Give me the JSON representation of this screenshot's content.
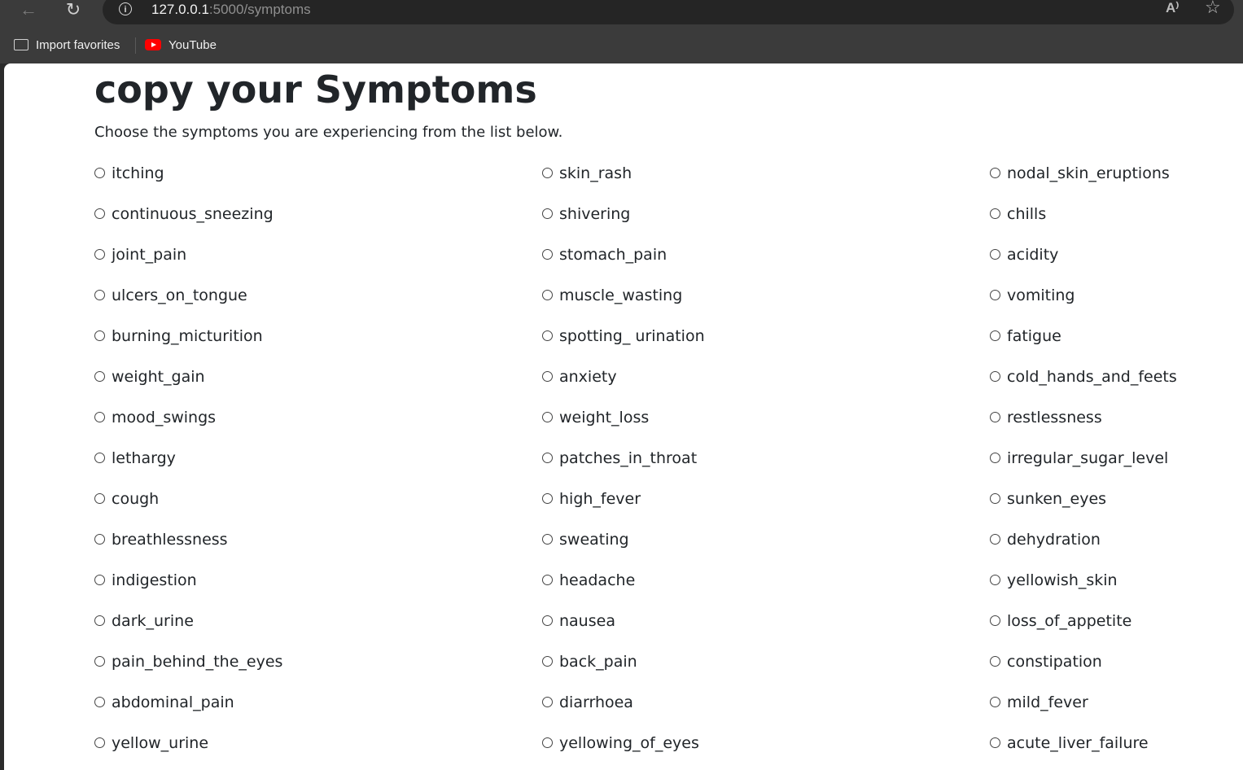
{
  "browser": {
    "url_host": "127.0.0.1",
    "url_rest": ":5000/symptoms",
    "back_icon": "←",
    "reload_icon": "↻",
    "info_icon": "i",
    "read_aloud_icon": "A⁾",
    "favorite_icon": "☆",
    "bookmarks": [
      {
        "label": "Import favorites",
        "icon": "folder-import-icon"
      },
      {
        "label": "YouTube",
        "icon": "youtube-icon"
      }
    ]
  },
  "page": {
    "title": "copy your Symptoms",
    "subtitle": "Choose the symptoms you are experiencing from the list below.",
    "symptoms": [
      "itching",
      "skin_rash",
      "nodal_skin_eruptions",
      "continuous_sneezing",
      "shivering",
      "chills",
      "joint_pain",
      "stomach_pain",
      "acidity",
      "ulcers_on_tongue",
      "muscle_wasting",
      "vomiting",
      "burning_micturition",
      "spotting_ urination",
      "fatigue",
      "weight_gain",
      "anxiety",
      "cold_hands_and_feets",
      "mood_swings",
      "weight_loss",
      "restlessness",
      "lethargy",
      "patches_in_throat",
      "irregular_sugar_level",
      "cough",
      "high_fever",
      "sunken_eyes",
      "breathlessness",
      "sweating",
      "dehydration",
      "indigestion",
      "headache",
      "yellowish_skin",
      "dark_urine",
      "nausea",
      "loss_of_appetite",
      "pain_behind_the_eyes",
      "back_pain",
      "constipation",
      "abdominal_pain",
      "diarrhoea",
      "mild_fever",
      "yellow_urine",
      "yellowing_of_eyes",
      "acute_liver_failure"
    ]
  }
}
